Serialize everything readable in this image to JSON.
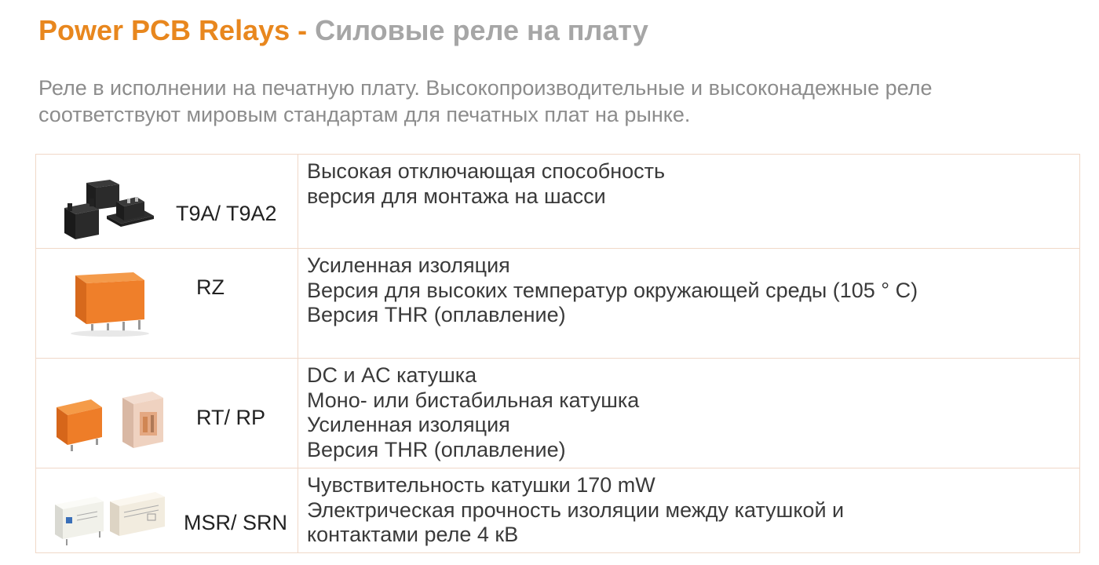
{
  "header": {
    "title_en": "Power PCB Relays",
    "title_sep": " - ",
    "title_ru": "Силовые реле на плату"
  },
  "intro": "Реле в исполнении на печатную плату. Высокопроизводительные и высоконадежные реле соответствуют мировым стандартам для печатных плат на рынке.",
  "colors": {
    "accent": "#e8871e",
    "subtitle_grey": "#a6a6a6",
    "body_grey": "#8c8c8c",
    "border": "#f0d8c8"
  },
  "products": [
    {
      "model": "T9A/ T9A2",
      "features": [
        "Высокая отключающая способность",
        "версия для монтажа на шасси"
      ]
    },
    {
      "model": "RZ",
      "features": [
        "Усиленная изоляция",
        "Версия для высоких температур окружающей среды (105 ° C)",
        "Версия THR (оплавление)"
      ]
    },
    {
      "model": "RT/ RP",
      "features": [
        "DC и AC катушка",
        "Моно- или бистабильная катушка",
        "Усиленная изоляция",
        "Версия THR (оплавление)"
      ]
    },
    {
      "model": "MSR/ SRN",
      "features": [
        "Чувствительность катушки 170 mW",
        "Электрическая прочность изоляции между катушкой и",
        "контактами реле 4 кВ"
      ]
    }
  ]
}
